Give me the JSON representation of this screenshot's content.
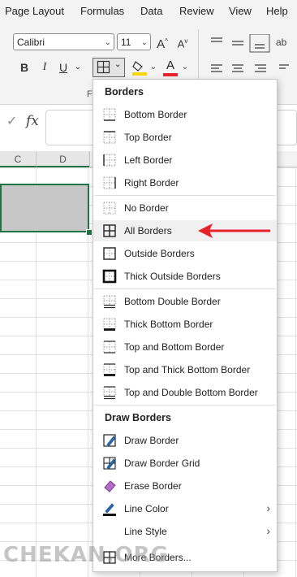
{
  "ribbon_tabs": [
    "Page Layout",
    "Formulas",
    "Data",
    "Review",
    "View",
    "Help"
  ],
  "font": {
    "name": "Calibri",
    "size": "11"
  },
  "format_buttons": {
    "bold": "B",
    "italic": "I",
    "underline": "U",
    "grow": "A",
    "shrink": "A",
    "font_color": "A"
  },
  "group_label": "F",
  "formula_bar": {
    "fx": "fx"
  },
  "columns": [
    "C",
    "D"
  ],
  "menu": {
    "header": "Borders",
    "items": [
      "Bottom Border",
      "Top Border",
      "Left Border",
      "Right Border",
      "No Border",
      "All Borders",
      "Outside Borders",
      "Thick Outside Borders",
      "Bottom Double Border",
      "Thick Bottom Border",
      "Top and Bottom Border",
      "Top and Thick Bottom Border",
      "Top and Double Bottom Border"
    ],
    "draw_header": "Draw Borders",
    "draw_items": [
      "Draw Border",
      "Draw Border Grid",
      "Erase Border",
      "Line Color",
      "Line Style",
      "More Borders..."
    ]
  },
  "highlighted_item": "All Borders",
  "colors": {
    "accent": "#217346",
    "arrow": "#e8222b",
    "font_color_bar": "#e8222b",
    "highlight_bar": "#f5d800"
  },
  "watermark": "CHEKAN.ORG"
}
